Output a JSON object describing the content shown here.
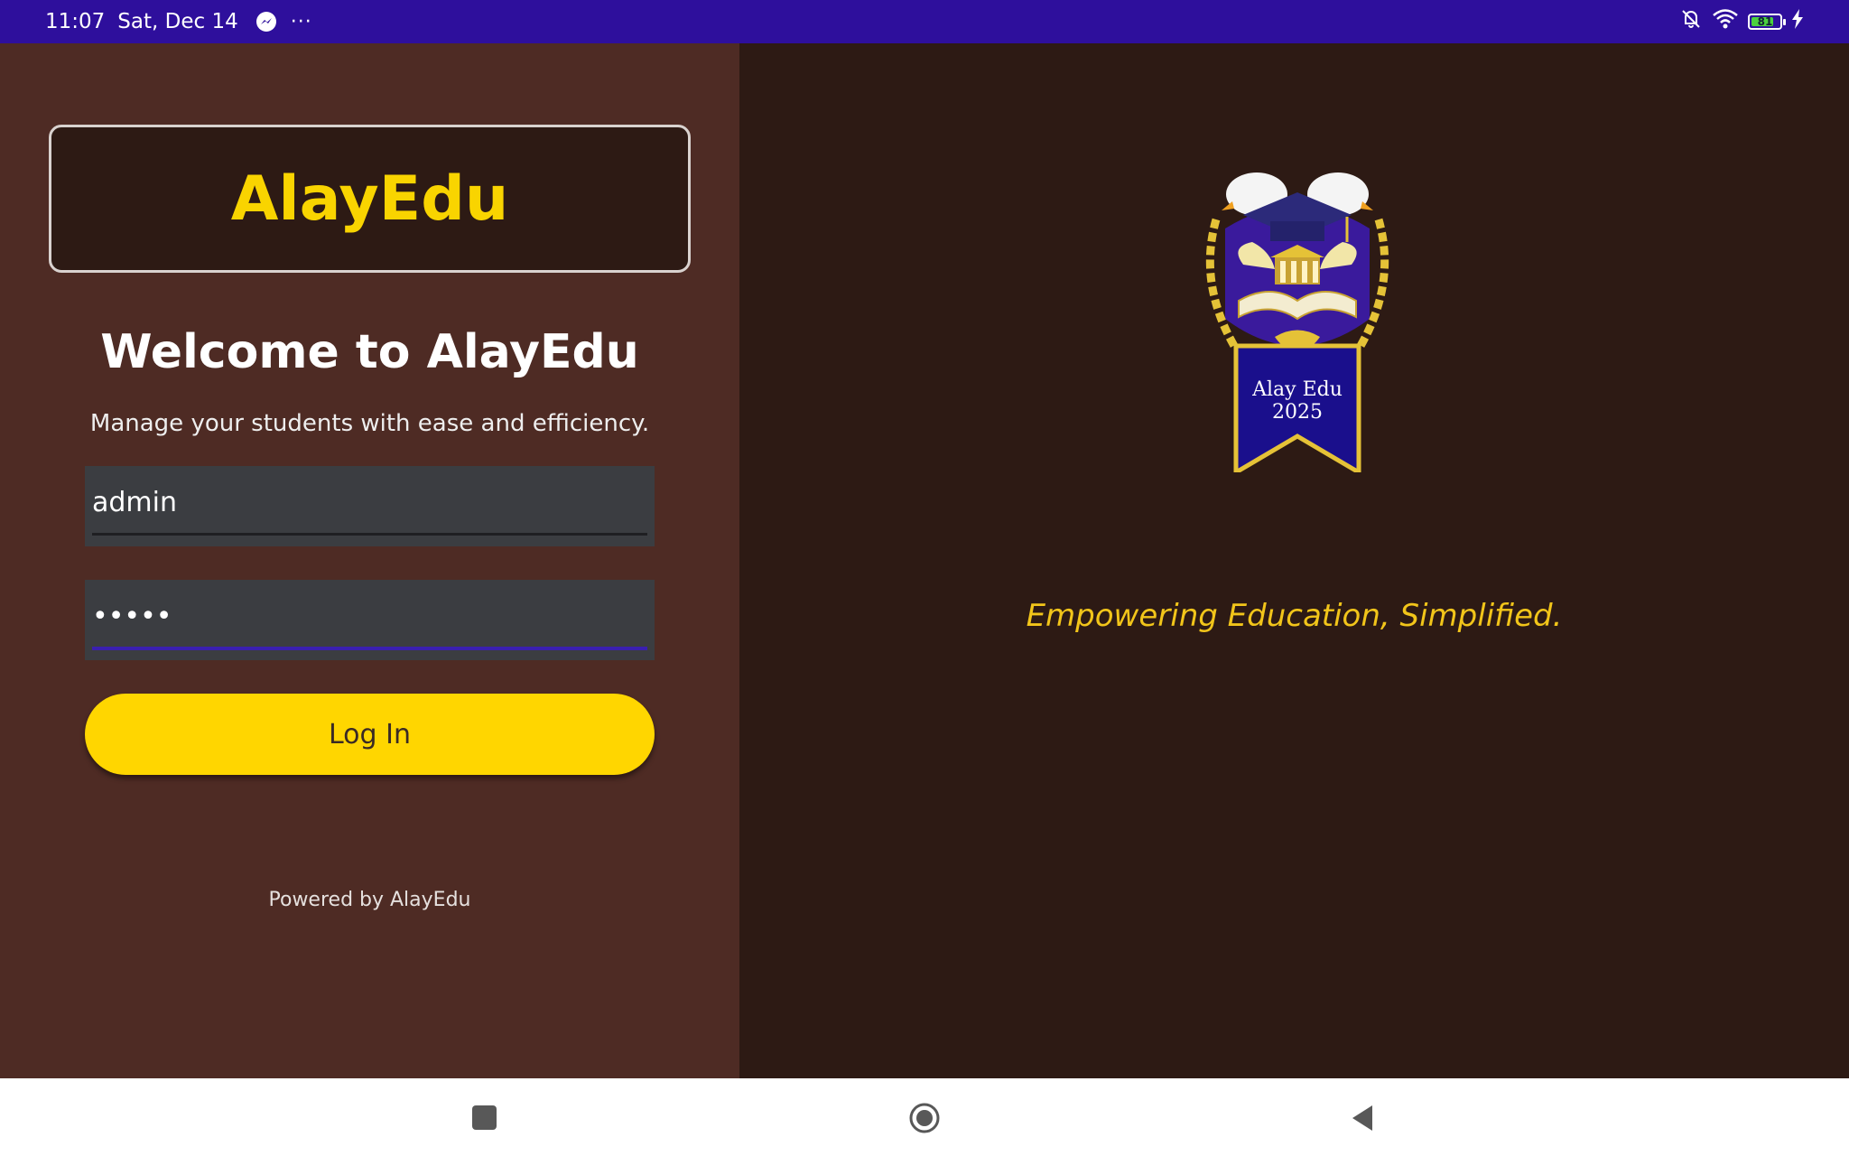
{
  "status_bar": {
    "time": "11:07",
    "date": "Sat, Dec 14",
    "more": "···",
    "battery_level": "81",
    "icons": [
      "messenger-icon",
      "bell-off-icon",
      "wifi-icon",
      "battery-icon",
      "charging-icon"
    ]
  },
  "login": {
    "brand_title": "AlayEdu",
    "welcome": "Welcome to AlayEdu",
    "subtitle": "Manage your students with ease and efficiency.",
    "username_value": "admin",
    "password_value": "•••••",
    "login_label": "Log In",
    "powered_by": "Powered by AlayEdu"
  },
  "hero": {
    "logo_line1": "Alay Edu",
    "logo_line2": "2025",
    "tagline": "Empowering Education, Simplified."
  },
  "nav_bar": {
    "icons": [
      "recent-apps-icon",
      "home-icon",
      "back-icon"
    ]
  },
  "colors": {
    "status_bar": "#2e0f9c",
    "left_panel": "#4e2b24",
    "right_panel": "#2d1a14",
    "accent_yellow": "#ffd600",
    "focus_underline": "#3a1fb0"
  }
}
